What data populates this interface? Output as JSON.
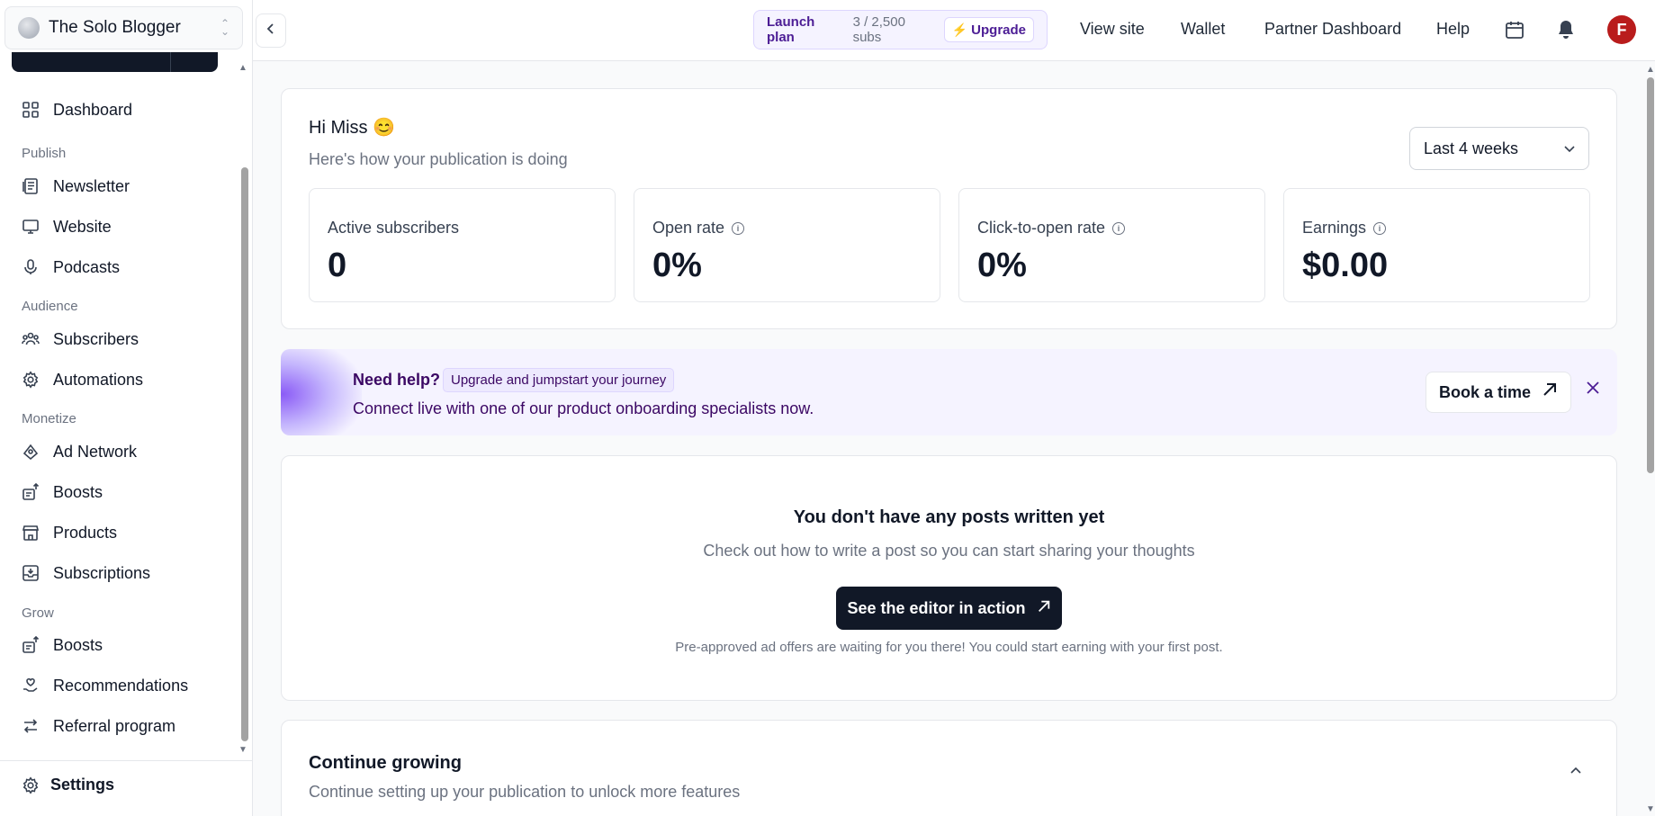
{
  "sidebar": {
    "publication_name": "The Solo Blogger",
    "items": [
      {
        "label": "Dashboard",
        "icon": "grid-icon"
      },
      {
        "section": "Publish"
      },
      {
        "label": "Newsletter",
        "icon": "newsletter-icon"
      },
      {
        "label": "Website",
        "icon": "monitor-icon"
      },
      {
        "label": "Podcasts",
        "icon": "microphone-icon"
      },
      {
        "section": "Audience"
      },
      {
        "label": "Subscribers",
        "icon": "users-icon"
      },
      {
        "label": "Automations",
        "icon": "cog-icon"
      },
      {
        "section": "Monetize"
      },
      {
        "label": "Ad Network",
        "icon": "ad-network-icon"
      },
      {
        "label": "Boosts",
        "icon": "boost-icon"
      },
      {
        "label": "Products",
        "icon": "store-icon"
      },
      {
        "label": "Subscriptions",
        "icon": "inbox-icon"
      },
      {
        "section": "Grow"
      },
      {
        "label": "Boosts",
        "icon": "boost-icon"
      },
      {
        "label": "Recommendations",
        "icon": "heart-hand-icon"
      },
      {
        "label": "Referral program",
        "icon": "arrows-swap-icon"
      }
    ],
    "settings_label": "Settings"
  },
  "topbar": {
    "plan_name": "Launch plan",
    "plan_subs": "3 / 2,500 subs",
    "upgrade_label": "Upgrade",
    "links": [
      "View site",
      "Wallet",
      "Partner Dashboard",
      "Help"
    ],
    "avatar_letter": "F",
    "avatar_color": "#b91c1c"
  },
  "overview": {
    "greeting": "Hi Miss 😊",
    "subtitle": "Here's how your publication is doing",
    "range": "Last 4 weeks",
    "stats": [
      {
        "label": "Active subscribers",
        "value": "0",
        "info": false
      },
      {
        "label": "Open rate",
        "value": "0%",
        "info": true
      },
      {
        "label": "Click-to-open rate",
        "value": "0%",
        "info": true
      },
      {
        "label": "Earnings",
        "value": "$0.00",
        "info": true
      }
    ]
  },
  "help_banner": {
    "title": "Need help?",
    "chip": "Upgrade and jumpstart your journey",
    "subtitle": "Connect live with one of our product onboarding specialists now.",
    "button": "Book a time"
  },
  "empty_posts": {
    "title": "You don't have any posts written yet",
    "subtitle": "Check out how to write a post so you can start sharing your thoughts",
    "button": "See the editor in action",
    "note": "Pre-approved ad offers are waiting for you there! You could start earning with your first post."
  },
  "continue_growing": {
    "title": "Continue growing",
    "subtitle": "Continue setting up your publication to unlock more features"
  }
}
